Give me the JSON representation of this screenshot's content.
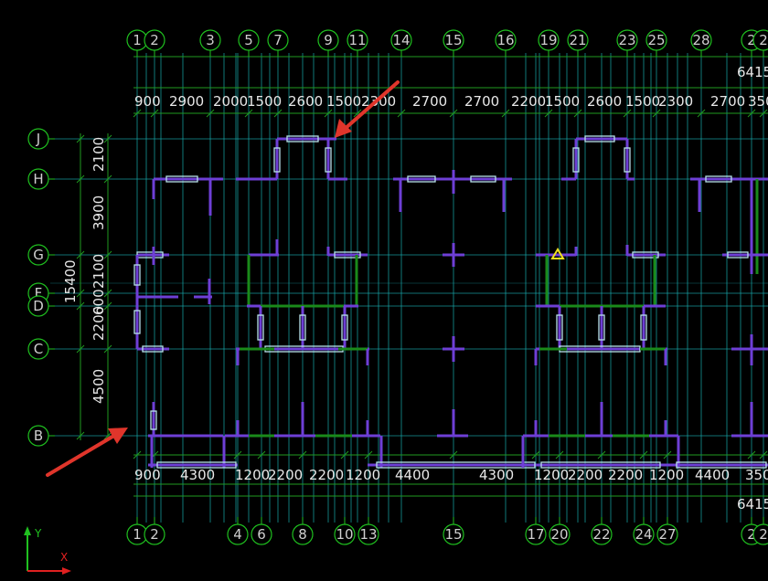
{
  "colors": {
    "background": "#000000",
    "grid_line": "#19b0b3",
    "bubble": "#1fbf1f",
    "dim_line": "#1f9a1f",
    "wall": "#6e3fd6",
    "beam": "#1a8a1a",
    "window": "#b8e2ec",
    "arrow": "#e0352b",
    "marker": "#f0e020",
    "ucs_x": "#e02020",
    "ucs_y": "#20c020"
  },
  "top_axes": [
    "1",
    "2",
    "3",
    "5",
    "7",
    "9",
    "11",
    "14",
    "15",
    "16",
    "19",
    "21",
    "23",
    "25",
    "28",
    "2",
    "2"
  ],
  "bottom_axes": [
    "1",
    "2",
    "4",
    "6",
    "8",
    "10",
    "13",
    "15",
    "17",
    "20",
    "22",
    "24",
    "27",
    "2",
    "2"
  ],
  "left_axes": [
    "J",
    "H",
    "G",
    "F",
    "D",
    "C",
    "B"
  ],
  "top_dims": [
    "900",
    "2900",
    "2000",
    "1500",
    "2600",
    "1500",
    "2300",
    "2700",
    "2700",
    "2200",
    "1500",
    "2600",
    "1500",
    "2300",
    "2700",
    "350"
  ],
  "bottom_dims": [
    "900",
    "4300",
    "1200",
    "2200",
    "2200",
    "1200",
    "4400",
    "4300",
    "1200",
    "2200",
    "2200",
    "1200",
    "4400",
    "350"
  ],
  "left_dims": [
    "2100",
    "3900",
    "2100",
    "600",
    "2200",
    "4500"
  ],
  "total_top": "6415",
  "total_bottom": "6415",
  "total_left": "15400",
  "ucs": {
    "y_label": "Y",
    "x_label": "X"
  },
  "arrow_icon": "red-arrow-icon",
  "marker_icon": "yellow-triangle-marker-icon"
}
